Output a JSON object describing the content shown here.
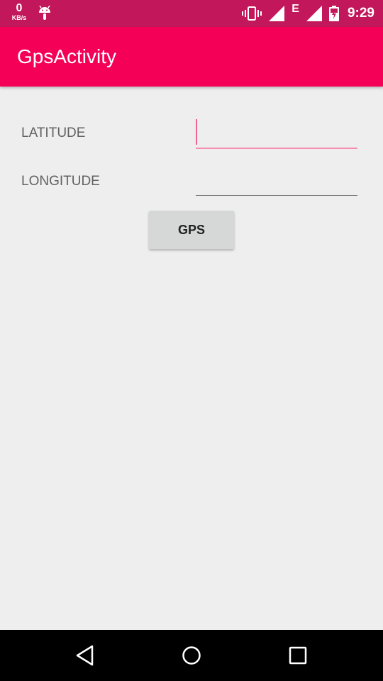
{
  "status_bar": {
    "net_speed_value": "0",
    "net_speed_unit": "KB/s",
    "network_type": "E",
    "time": "9:29",
    "icons": [
      "android-debug-icon",
      "vibrate-icon",
      "signal-icon",
      "signal-icon",
      "battery-charging-icon"
    ]
  },
  "app_bar": {
    "title": "GpsActivity"
  },
  "form": {
    "latitude_label": "LATITUDE",
    "latitude_value": "",
    "longitude_label": "LONGITUDE",
    "longitude_value": "",
    "gps_button_label": "GPS"
  },
  "nav_bar": {
    "icons": [
      "back-icon",
      "home-icon",
      "recents-icon"
    ]
  },
  "colors": {
    "status_bar": "#c2185b",
    "app_bar": "#f50057",
    "background": "#eeeeee",
    "accent": "#f48fb1"
  }
}
